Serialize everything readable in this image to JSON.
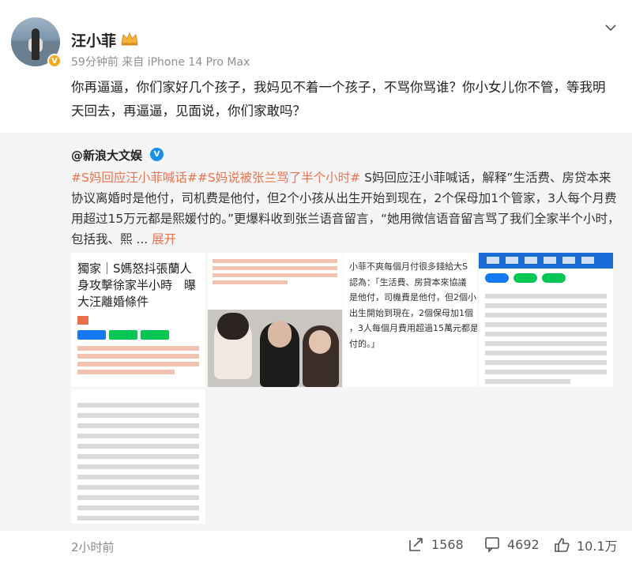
{
  "post": {
    "author": "汪小菲",
    "meta": "59分钟前  来自 iPhone 14 Pro Max",
    "text": "你再逼逼，你们家好几个孩子，我妈见不着一个孩子，不骂你骂谁？你小女儿你不管，等我明天回去，再逼逼，见面说，你们家敢吗？"
  },
  "repost": {
    "author": "@新浪大文娱",
    "tag1": "#S妈回应汪小菲喊话#",
    "tag2": "#S妈说被张兰骂了半个小时#",
    "body": " S妈回应汪小菲喊话，解释”生活费、房贷本来协议离婚时是他付，司机费是他付，但2个小孩从出生开始到现在，2个保母加1个管家，3人每个月费用超过15万元都是熙媛付的。”更爆料收到张兰语音留言，“她用微信语音留言骂了我们全家半个小时，包括我、熙 ... ",
    "more": "展开"
  },
  "images": {
    "img1": {
      "title": "獨家｜S媽怒抖張蘭人身攻擊徐家半小時　曝大汪離婚條件"
    },
    "img3": {
      "lines": [
        "小菲不爽每個月付很多錢給大S",
        "認為：「生活費、房貸本來協議",
        "是他付，司機費是他付，但2個小",
        "出生開始到現在，2個保母加1個",
        "，3人每個月費用超過15萬元都是",
        "付的。」"
      ]
    }
  },
  "footer": {
    "time": "2小时前",
    "reposts": "1568",
    "comments": "4692",
    "likes": "10.1万"
  },
  "colors": {
    "accent": "#eb7350",
    "verified_blue": "#1a90e8",
    "verified_gold": "#f6a81f"
  }
}
